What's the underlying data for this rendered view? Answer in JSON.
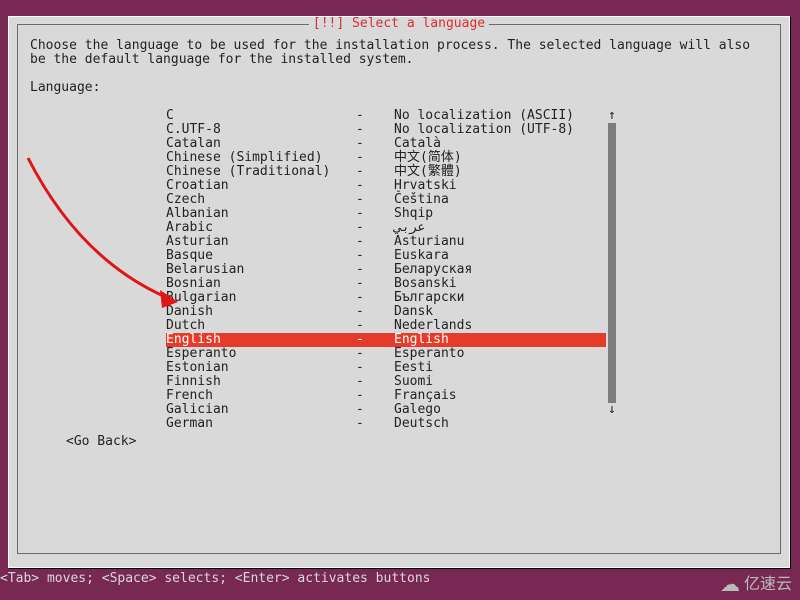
{
  "dialog": {
    "title": "[!!] Select a language",
    "instruction": "Choose the language to be used for the installation process. The selected language will also be the default language for the installed system.",
    "field_label": "Language:"
  },
  "languages": [
    {
      "name": "C",
      "sep": "-",
      "native": "No localization (ASCII)",
      "selected": false
    },
    {
      "name": "C.UTF-8",
      "sep": "-",
      "native": "No localization (UTF-8)",
      "selected": false
    },
    {
      "name": "Catalan",
      "sep": "-",
      "native": "Català",
      "selected": false
    },
    {
      "name": "Chinese (Simplified)",
      "sep": "-",
      "native": "中文(简体)",
      "selected": false
    },
    {
      "name": "Chinese (Traditional)",
      "sep": "-",
      "native": "中文(繁體)",
      "selected": false
    },
    {
      "name": "Croatian",
      "sep": "-",
      "native": "Hrvatski",
      "selected": false
    },
    {
      "name": "Czech",
      "sep": "-",
      "native": "Čeština",
      "selected": false
    },
    {
      "name": "Albanian",
      "sep": "-",
      "native": "Shqip",
      "selected": false
    },
    {
      "name": "Arabic",
      "sep": "-",
      "native": "عربي",
      "selected": false
    },
    {
      "name": "Asturian",
      "sep": "-",
      "native": "Asturianu",
      "selected": false
    },
    {
      "name": "Basque",
      "sep": "-",
      "native": "Euskara",
      "selected": false
    },
    {
      "name": "Belarusian",
      "sep": "-",
      "native": "Беларуская",
      "selected": false
    },
    {
      "name": "Bosnian",
      "sep": "-",
      "native": "Bosanski",
      "selected": false
    },
    {
      "name": "Bulgarian",
      "sep": "-",
      "native": "Български",
      "selected": false
    },
    {
      "name": "Danish",
      "sep": "-",
      "native": "Dansk",
      "selected": false
    },
    {
      "name": "Dutch",
      "sep": "-",
      "native": "Nederlands",
      "selected": false
    },
    {
      "name": "English",
      "sep": "-",
      "native": "English",
      "selected": true
    },
    {
      "name": "Esperanto",
      "sep": "-",
      "native": "Esperanto",
      "selected": false
    },
    {
      "name": "Estonian",
      "sep": "-",
      "native": "Eesti",
      "selected": false
    },
    {
      "name": "Finnish",
      "sep": "-",
      "native": "Suomi",
      "selected": false
    },
    {
      "name": "French",
      "sep": "-",
      "native": "Français",
      "selected": false
    },
    {
      "name": "Galician",
      "sep": "-",
      "native": "Galego",
      "selected": false
    },
    {
      "name": "German",
      "sep": "-",
      "native": "Deutsch",
      "selected": false
    }
  ],
  "go_back": "<Go Back>",
  "scroll": {
    "up": "↑",
    "down": "↓"
  },
  "footer": "<Tab> moves; <Space> selects; <Enter> activates buttons",
  "watermark": "亿速云"
}
